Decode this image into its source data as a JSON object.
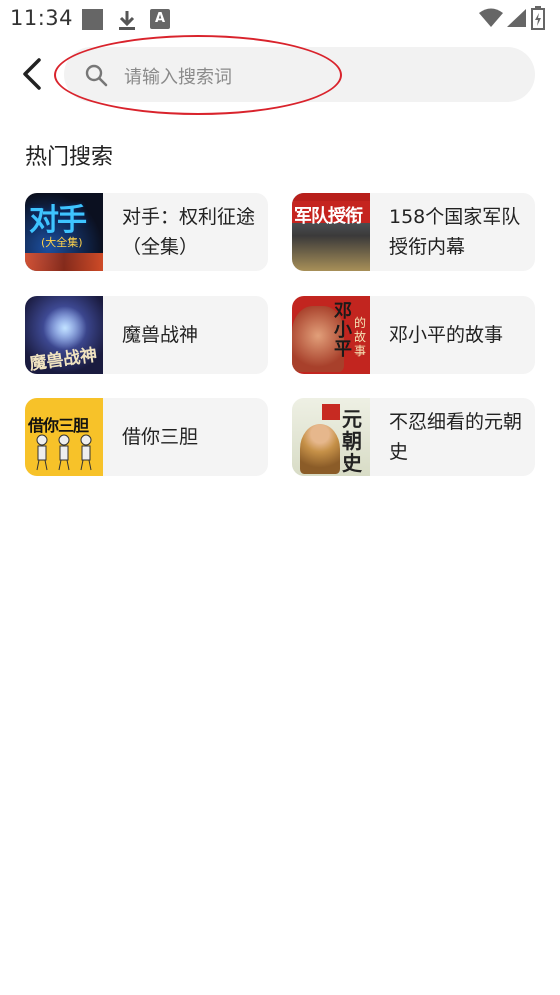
{
  "status_bar": {
    "time": "11:34",
    "icons": [
      "notification-square-icon",
      "download-icon",
      "a-letter-icon",
      "wifi-icon",
      "signal-icon",
      "battery-icon"
    ],
    "a_icon_letter": "A"
  },
  "header": {
    "back_icon": "chevron-left-icon",
    "search": {
      "placeholder": "请输入搜索词",
      "icon": "search-icon"
    },
    "annotation_color": "#d9232c"
  },
  "hot_search": {
    "title": "热门搜索",
    "items": [
      {
        "title": "对手：权利征途（全集）",
        "cover_text": "对手",
        "cover_subtext": "(大全集)"
      },
      {
        "title": "158个国家军队授衔内幕",
        "cover_text": "军队授衔"
      },
      {
        "title": "魔兽战神",
        "cover_text": "魔兽战神"
      },
      {
        "title": "邓小平的故事",
        "cover_text": "邓小平",
        "cover_subtext": "的故事"
      },
      {
        "title": "借你三胆",
        "cover_text": "借你三胆"
      },
      {
        "title": "不忍细看的元朝史",
        "cover_text": "元朝史"
      }
    ]
  },
  "colors": {
    "card_bg": "#f4f4f4",
    "search_bg": "#f2f2f2",
    "text": "#222222",
    "placeholder": "#8a8a8a"
  }
}
